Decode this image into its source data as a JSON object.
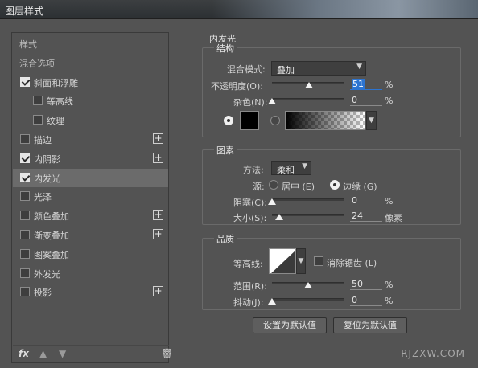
{
  "window": {
    "title": "图层样式"
  },
  "left_panel": {
    "items": [
      {
        "label": "样式",
        "header": true
      },
      {
        "label": "混合选项",
        "header": true
      },
      {
        "label": "斜面和浮雕",
        "checked": true,
        "plus": false
      },
      {
        "label": "等高线",
        "checked": false,
        "sub": true
      },
      {
        "label": "纹理",
        "checked": false,
        "sub": true
      },
      {
        "label": "描边",
        "checked": false,
        "plus": true
      },
      {
        "label": "内阴影",
        "checked": true,
        "plus": true
      },
      {
        "label": "内发光",
        "checked": true,
        "selected": true
      },
      {
        "label": "光泽",
        "checked": false
      },
      {
        "label": "颜色叠加",
        "checked": false,
        "plus": true
      },
      {
        "label": "渐变叠加",
        "checked": false,
        "plus": true
      },
      {
        "label": "图案叠加",
        "checked": false
      },
      {
        "label": "外发光",
        "checked": false
      },
      {
        "label": "投影",
        "checked": false,
        "plus": true
      }
    ],
    "fx_label": "fx",
    "up_icon": "arrow-up-icon",
    "down_icon": "arrow-down-icon",
    "trash_icon": "trash-icon"
  },
  "inner_glow": {
    "title": "内发光",
    "structure": {
      "title": "结构",
      "blend_mode_label": "混合模式:",
      "blend_mode_value": "叠加",
      "opacity_label": "不透明度(O):",
      "opacity_value": "51",
      "opacity_fraction": 0.51,
      "noise_label": "杂色(N):",
      "noise_value": "0",
      "noise_fraction": 0,
      "unit": "%",
      "color_swatch": "#000000"
    },
    "elements": {
      "title": "图素",
      "method_label": "方法:",
      "method_value": "柔和",
      "source_label": "源:",
      "source_center": "居中 (E)",
      "source_edge": "边缘 (G)",
      "choke_label": "阻塞(C):",
      "choke_value": "0",
      "choke_fraction": 0,
      "size_label": "大小(S):",
      "size_value": "24",
      "size_fraction": 0.1,
      "pct": "%",
      "px_unit": "像素"
    },
    "quality": {
      "title": "品质",
      "contour_label": "等高线:",
      "anti_alias_label": "消除锯齿 (L)",
      "range_label": "范围(R):",
      "range_value": "50",
      "range_fraction": 0.5,
      "jitter_label": "抖动(J):",
      "jitter_value": "0",
      "jitter_fraction": 0,
      "unit": "%"
    },
    "buttons": {
      "set_default": "设置为默认值",
      "reset_default": "复位为默认值"
    }
  },
  "watermark": "RJZXW.COM"
}
